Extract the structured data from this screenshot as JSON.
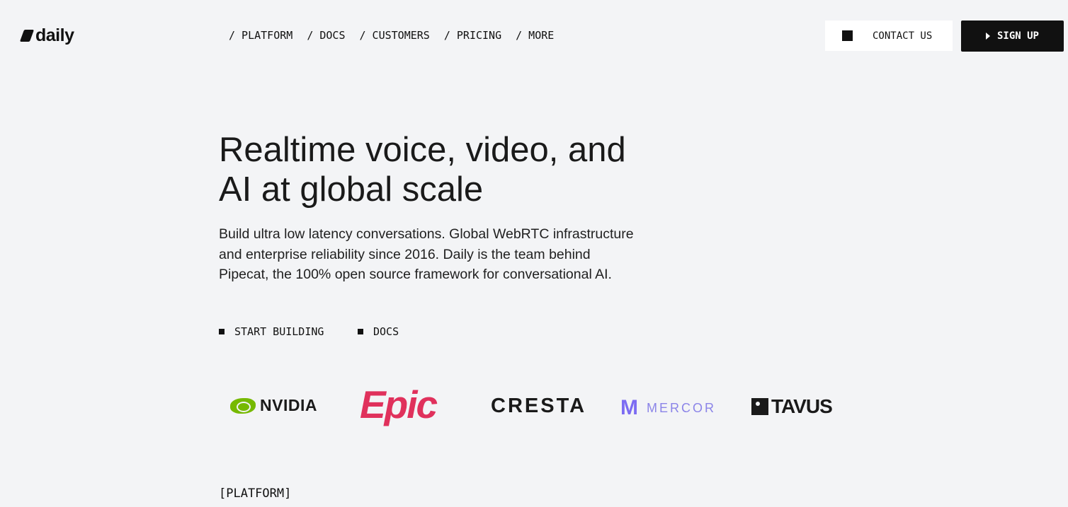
{
  "brand": {
    "name": "daily"
  },
  "nav": {
    "items": [
      "/ PLATFORM",
      "/ DOCS",
      "/ CUSTOMERS",
      "/ PRICING",
      "/ MORE"
    ]
  },
  "header": {
    "contact_label": "CONTACT US",
    "signup_label": "SIGN UP"
  },
  "hero": {
    "title_line1": "Realtime voice, video, and",
    "title_line2": "AI at global scale",
    "subtitle": "Build ultra low latency conversations. Global WebRTC infrastructure and enterprise reliability since 2016. Daily is the team behind Pipecat, the 100% open source framework for conversational AI.",
    "cta_primary": "START BUILDING",
    "cta_secondary": "DOCS"
  },
  "customers": {
    "logos": [
      "NVIDIA",
      "Epic",
      "CRESTA",
      "MERCOR",
      "TAVUS"
    ]
  },
  "section": {
    "label": "[PLATFORM]"
  },
  "colors": {
    "background": "#f3f4f6",
    "text": "#111111",
    "nvidia_green": "#76b900",
    "epic_pink": "#e0315c",
    "mercor_purple": "#7c6cf2"
  }
}
